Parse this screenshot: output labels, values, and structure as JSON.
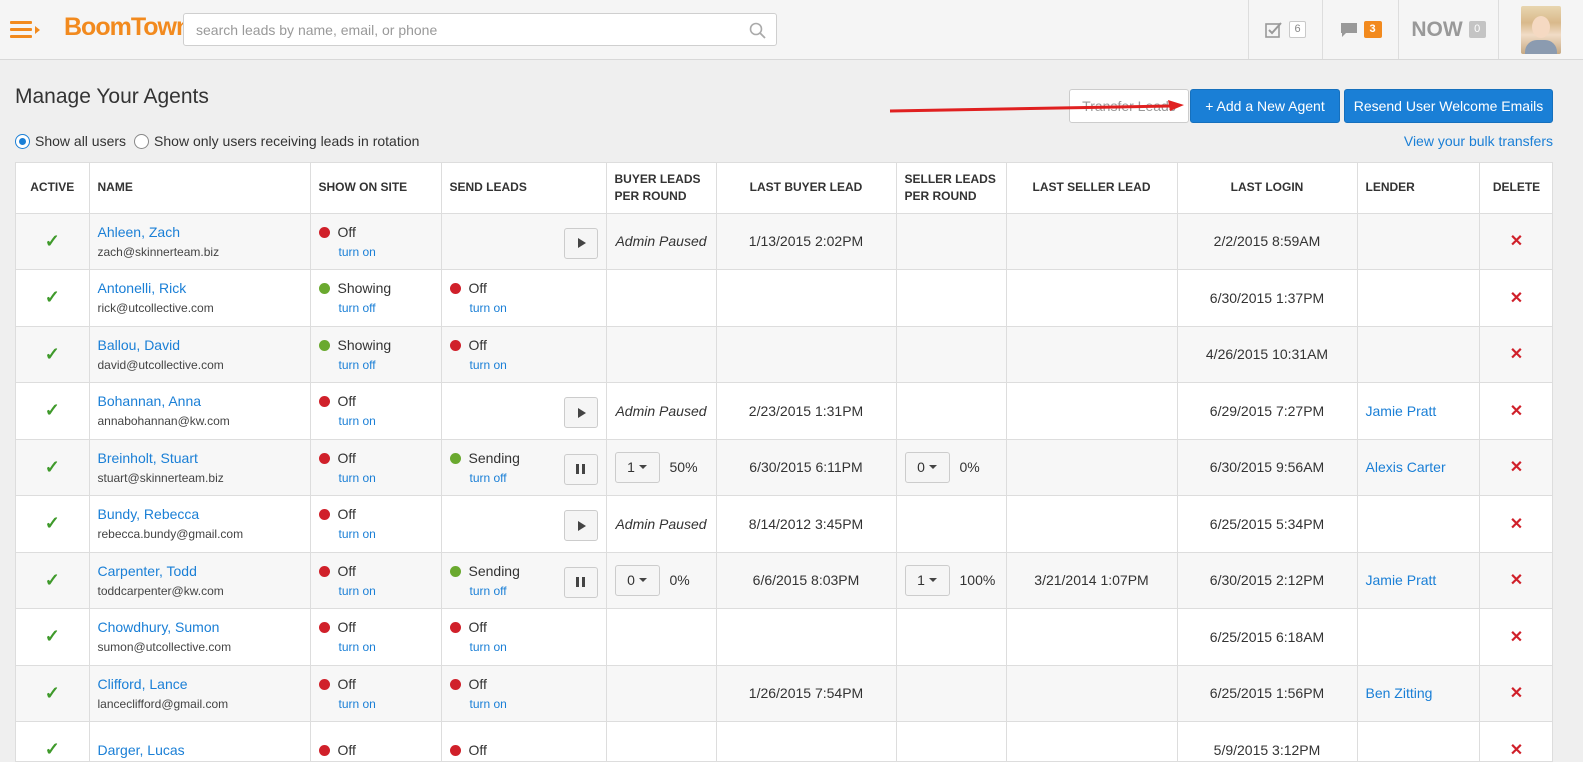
{
  "header": {
    "logo_text_a": "Boom",
    "logo_text_b": "Town!",
    "search_placeholder": "search leads by name, email, or phone",
    "tasks_count": "6",
    "messages_count": "3",
    "now_label": "NOW",
    "now_count": "0",
    "colors": {
      "brand": "#f28a1e",
      "primary": "#1a7fd6"
    }
  },
  "page": {
    "title": "Manage Your Agents",
    "transfer_button": "Transfer Leads",
    "add_button": "+ Add a New Agent",
    "resend_button": "Resend User Welcome Emails",
    "filter_all": "Show all users",
    "filter_rotation": "Show only users receiving leads in rotation",
    "bulk_link": "View your bulk transfers"
  },
  "table": {
    "columns": {
      "active": "ACTIVE",
      "name": "NAME",
      "show_on_site": "SHOW ON SITE",
      "send_leads": "SEND LEADS",
      "buyer_leads_a": "BUYER LEADS",
      "buyer_leads_b": "PER ROUND",
      "last_buyer": "LAST BUYER LEAD",
      "seller_leads_a": "SELLER LEADS",
      "seller_leads_b": "PER ROUND",
      "last_seller": "LAST SELLER LEAD",
      "last_login": "LAST LOGIN",
      "lender": "LENDER",
      "delete": "DELETE"
    },
    "rows": [
      {
        "name": "Ahleen, Zach",
        "email": "zach@skinnerteam.biz",
        "show_status": "Off",
        "show_toggle": "turn on",
        "buyer_paused": "Admin Paused",
        "last_buyer": "1/13/2015 2:02PM",
        "last_login": "2/2/2015 8:59AM"
      },
      {
        "name": "Antonelli, Rick",
        "email": "rick@utcollective.com",
        "show_status": "Showing",
        "show_toggle": "turn off",
        "send_status": "Off",
        "send_toggle": "turn on",
        "last_login": "6/30/2015 1:37PM"
      },
      {
        "name": "Ballou, David",
        "email": "david@utcollective.com",
        "show_status": "Showing",
        "show_toggle": "turn off",
        "send_status": "Off",
        "send_toggle": "turn on",
        "last_login": "4/26/2015 10:31AM"
      },
      {
        "name": "Bohannan, Anna",
        "email": "annabohannan@kw.com",
        "show_status": "Off",
        "show_toggle": "turn on",
        "buyer_paused": "Admin Paused",
        "last_buyer": "2/23/2015 1:31PM",
        "last_login": "6/29/2015 7:27PM",
        "lender": "Jamie Pratt"
      },
      {
        "name": "Breinholt, Stuart",
        "email": "stuart@skinnerteam.biz",
        "show_status": "Off",
        "show_toggle": "turn on",
        "send_status": "Sending",
        "send_toggle": "turn off",
        "buyer_round": "1",
        "buyer_pct": "50%",
        "last_buyer": "6/30/2015 6:11PM",
        "seller_round": "0",
        "seller_pct": "0%",
        "last_login": "6/30/2015 9:56AM",
        "lender": "Alexis Carter"
      },
      {
        "name": "Bundy, Rebecca",
        "email": "rebecca.bundy@gmail.com",
        "show_status": "Off",
        "show_toggle": "turn on",
        "buyer_paused": "Admin Paused",
        "last_buyer": "8/14/2012 3:45PM",
        "last_login": "6/25/2015 5:34PM"
      },
      {
        "name": "Carpenter, Todd",
        "email": "toddcarpenter@kw.com",
        "show_status": "Off",
        "show_toggle": "turn on",
        "send_status": "Sending",
        "send_toggle": "turn off",
        "buyer_round": "0",
        "buyer_pct": "0%",
        "last_buyer": "6/6/2015 8:03PM",
        "seller_round": "1",
        "seller_pct": "100%",
        "last_seller": "3/21/2014 1:07PM",
        "last_login": "6/30/2015 2:12PM",
        "lender": "Jamie Pratt"
      },
      {
        "name": "Chowdhury, Sumon",
        "email": "sumon@utcollective.com",
        "show_status": "Off",
        "show_toggle": "turn on",
        "send_status": "Off",
        "send_toggle": "turn on",
        "last_login": "6/25/2015 6:18AM"
      },
      {
        "name": "Clifford, Lance",
        "email": "lanceclifford@gmail.com",
        "show_status": "Off",
        "show_toggle": "turn on",
        "send_status": "Off",
        "send_toggle": "turn on",
        "last_buyer": "1/26/2015 7:54PM",
        "last_login": "6/25/2015 1:56PM",
        "lender": "Ben Zitting"
      },
      {
        "name": "Darger, Lucas",
        "email": "",
        "show_status": "Off",
        "show_toggle": "",
        "send_status": "Off",
        "send_toggle": "",
        "last_login": "5/9/2015 3:12PM"
      }
    ]
  },
  "icons": {
    "check": "check-icon",
    "delete": "close-icon",
    "play": "play-icon",
    "pause": "pause-icon"
  }
}
